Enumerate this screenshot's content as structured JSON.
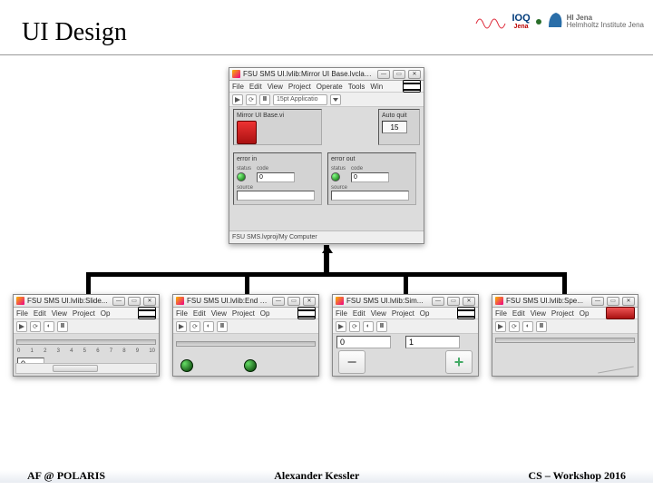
{
  "slide": {
    "title": "UI Design",
    "footer_left": "AF @ POLARIS",
    "footer_center": "Alexander Kessler",
    "footer_right": "CS – Workshop 2016"
  },
  "logos": {
    "ioq_main": "IOQ",
    "ioq_sub": "Jena",
    "hi_main": "HI Jena",
    "hi_sub": "Helmholtz Institute Jena"
  },
  "main_window": {
    "title": "FSU SMS UI.lvlib:Mirror UI Base.lvclass:vi...",
    "menu": [
      "File",
      "Edit",
      "View",
      "Project",
      "Operate",
      "Tools",
      "Win"
    ],
    "tb_app": "15pt Applicatio",
    "panel_title": "Mirror UI Base.vi",
    "autoquit": "Auto quit",
    "autoquit_val": "15",
    "error_in_lbl": "error in",
    "error_out_lbl": "error out",
    "status_lbl": "status",
    "code_lbl": "code",
    "source_lbl": "source",
    "code_in": "0",
    "code_out": "0",
    "status": "FSU SMS.lvproj/My Computer"
  },
  "child1": {
    "title": "FSU SMS UI.lvlib:Slide...",
    "menu": [
      "File",
      "Edit",
      "View",
      "Project",
      "Op"
    ],
    "ticks": [
      "0",
      "1",
      "2",
      "3",
      "4",
      "5",
      "6",
      "7",
      "8",
      "9",
      "10"
    ],
    "val": "0"
  },
  "child2": {
    "title": "FSU SMS UI.lvlib:End C...",
    "menu": [
      "File",
      "Edit",
      "View",
      "Project",
      "Op"
    ]
  },
  "child3": {
    "title": "FSU SMS UI.lvlib:Sim...",
    "menu": [
      "File",
      "Edit",
      "View",
      "Project",
      "Op"
    ],
    "val0": "0",
    "val1": "1"
  },
  "child4": {
    "title": "FSU SMS UI.lvlib:Spe...",
    "menu": [
      "File",
      "Edit",
      "View",
      "Project",
      "Op"
    ]
  }
}
